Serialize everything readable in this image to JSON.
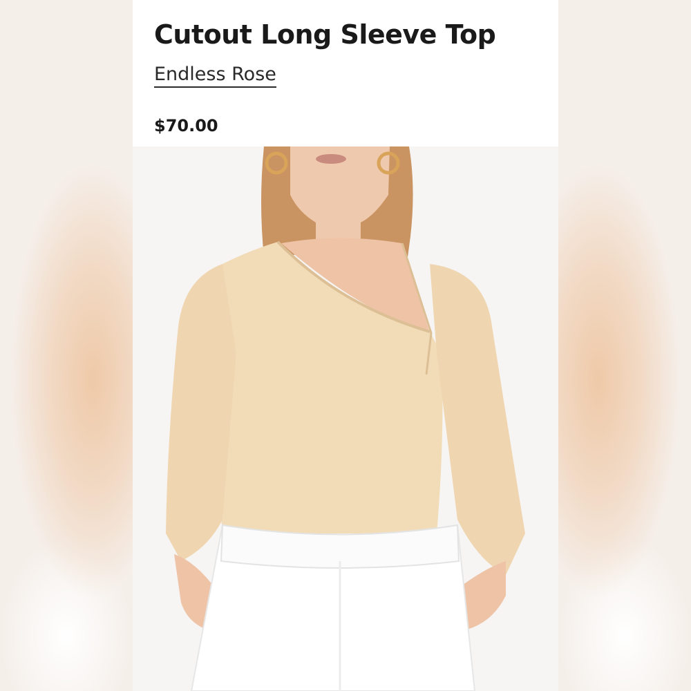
{
  "product": {
    "title": "Cutout Long Sleeve Top",
    "brand": "Endless Rose",
    "price": "$70.00"
  },
  "image": {
    "alt": "Model wearing a cream asymmetric cutout long sleeve knit top with white trousers"
  },
  "colors": {
    "top": "#f2dcb8",
    "pants": "#ffffff",
    "skin": "#eec3a6",
    "hair": "#c9905c",
    "background": "#f6f5f4"
  }
}
